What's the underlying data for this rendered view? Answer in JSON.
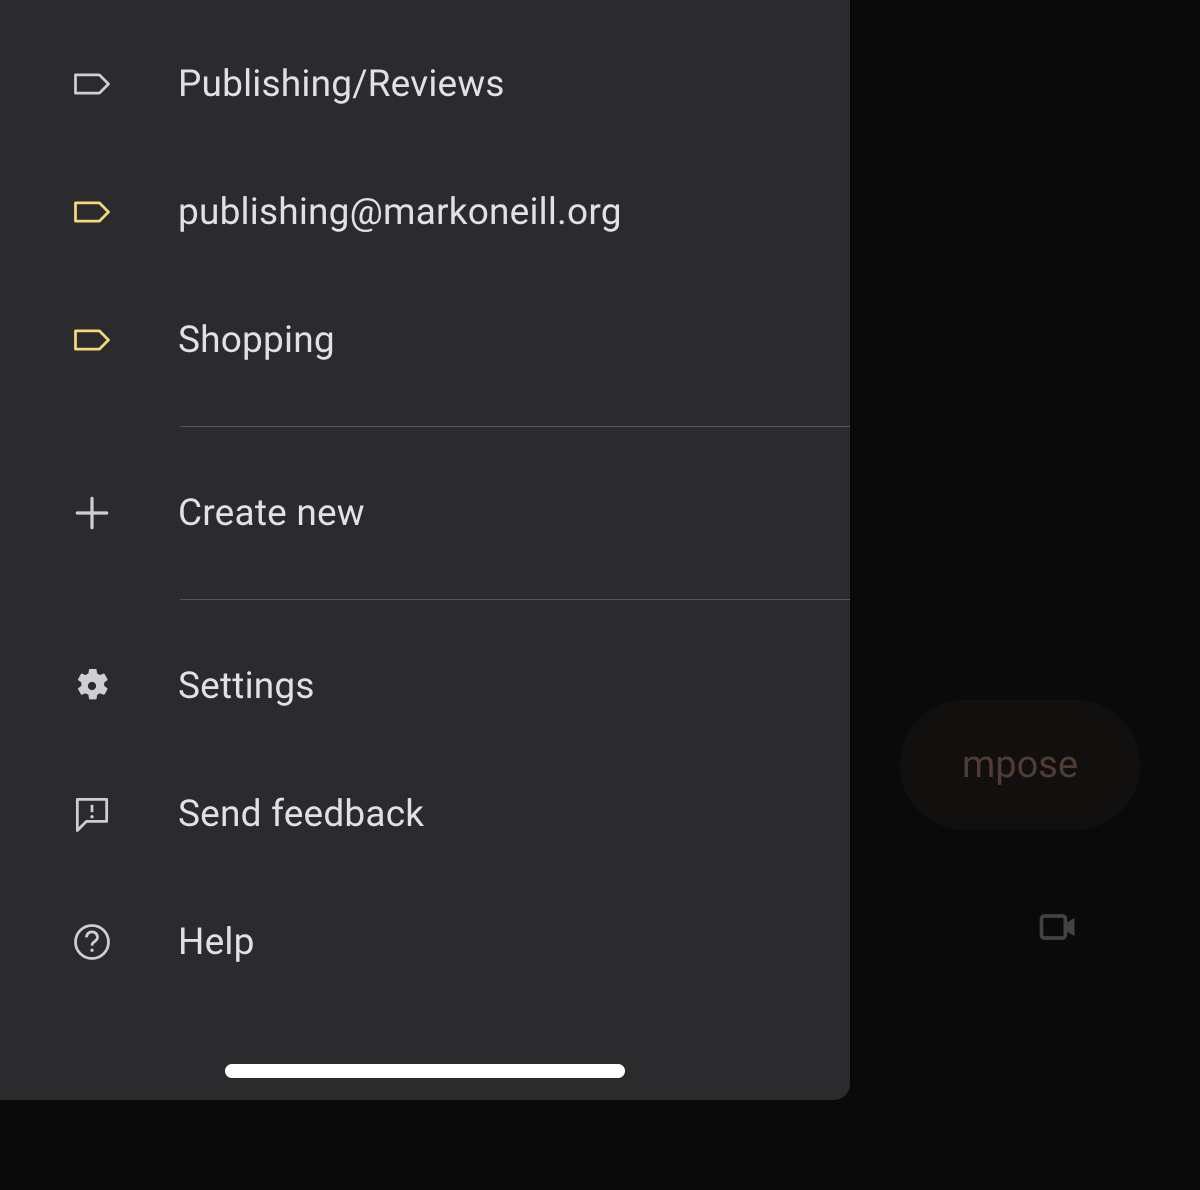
{
  "drawer": {
    "labels": [
      {
        "text": "Publishing/Reviews",
        "color": "default"
      },
      {
        "text": "publishing@markoneill.org",
        "color": "yellow"
      },
      {
        "text": "Shopping",
        "color": "yellow"
      }
    ],
    "create_label": "Create new",
    "settings_label": "Settings",
    "feedback_label": "Send feedback",
    "help_label": "Help"
  },
  "compose": {
    "visible_text": "mpose"
  },
  "colors": {
    "drawer_bg": "#2b2b2e",
    "text": "#e1e1e4",
    "icon": "#cfcfd1",
    "label_yellow": "#f2d97a",
    "compose_text": "#a8796b"
  }
}
